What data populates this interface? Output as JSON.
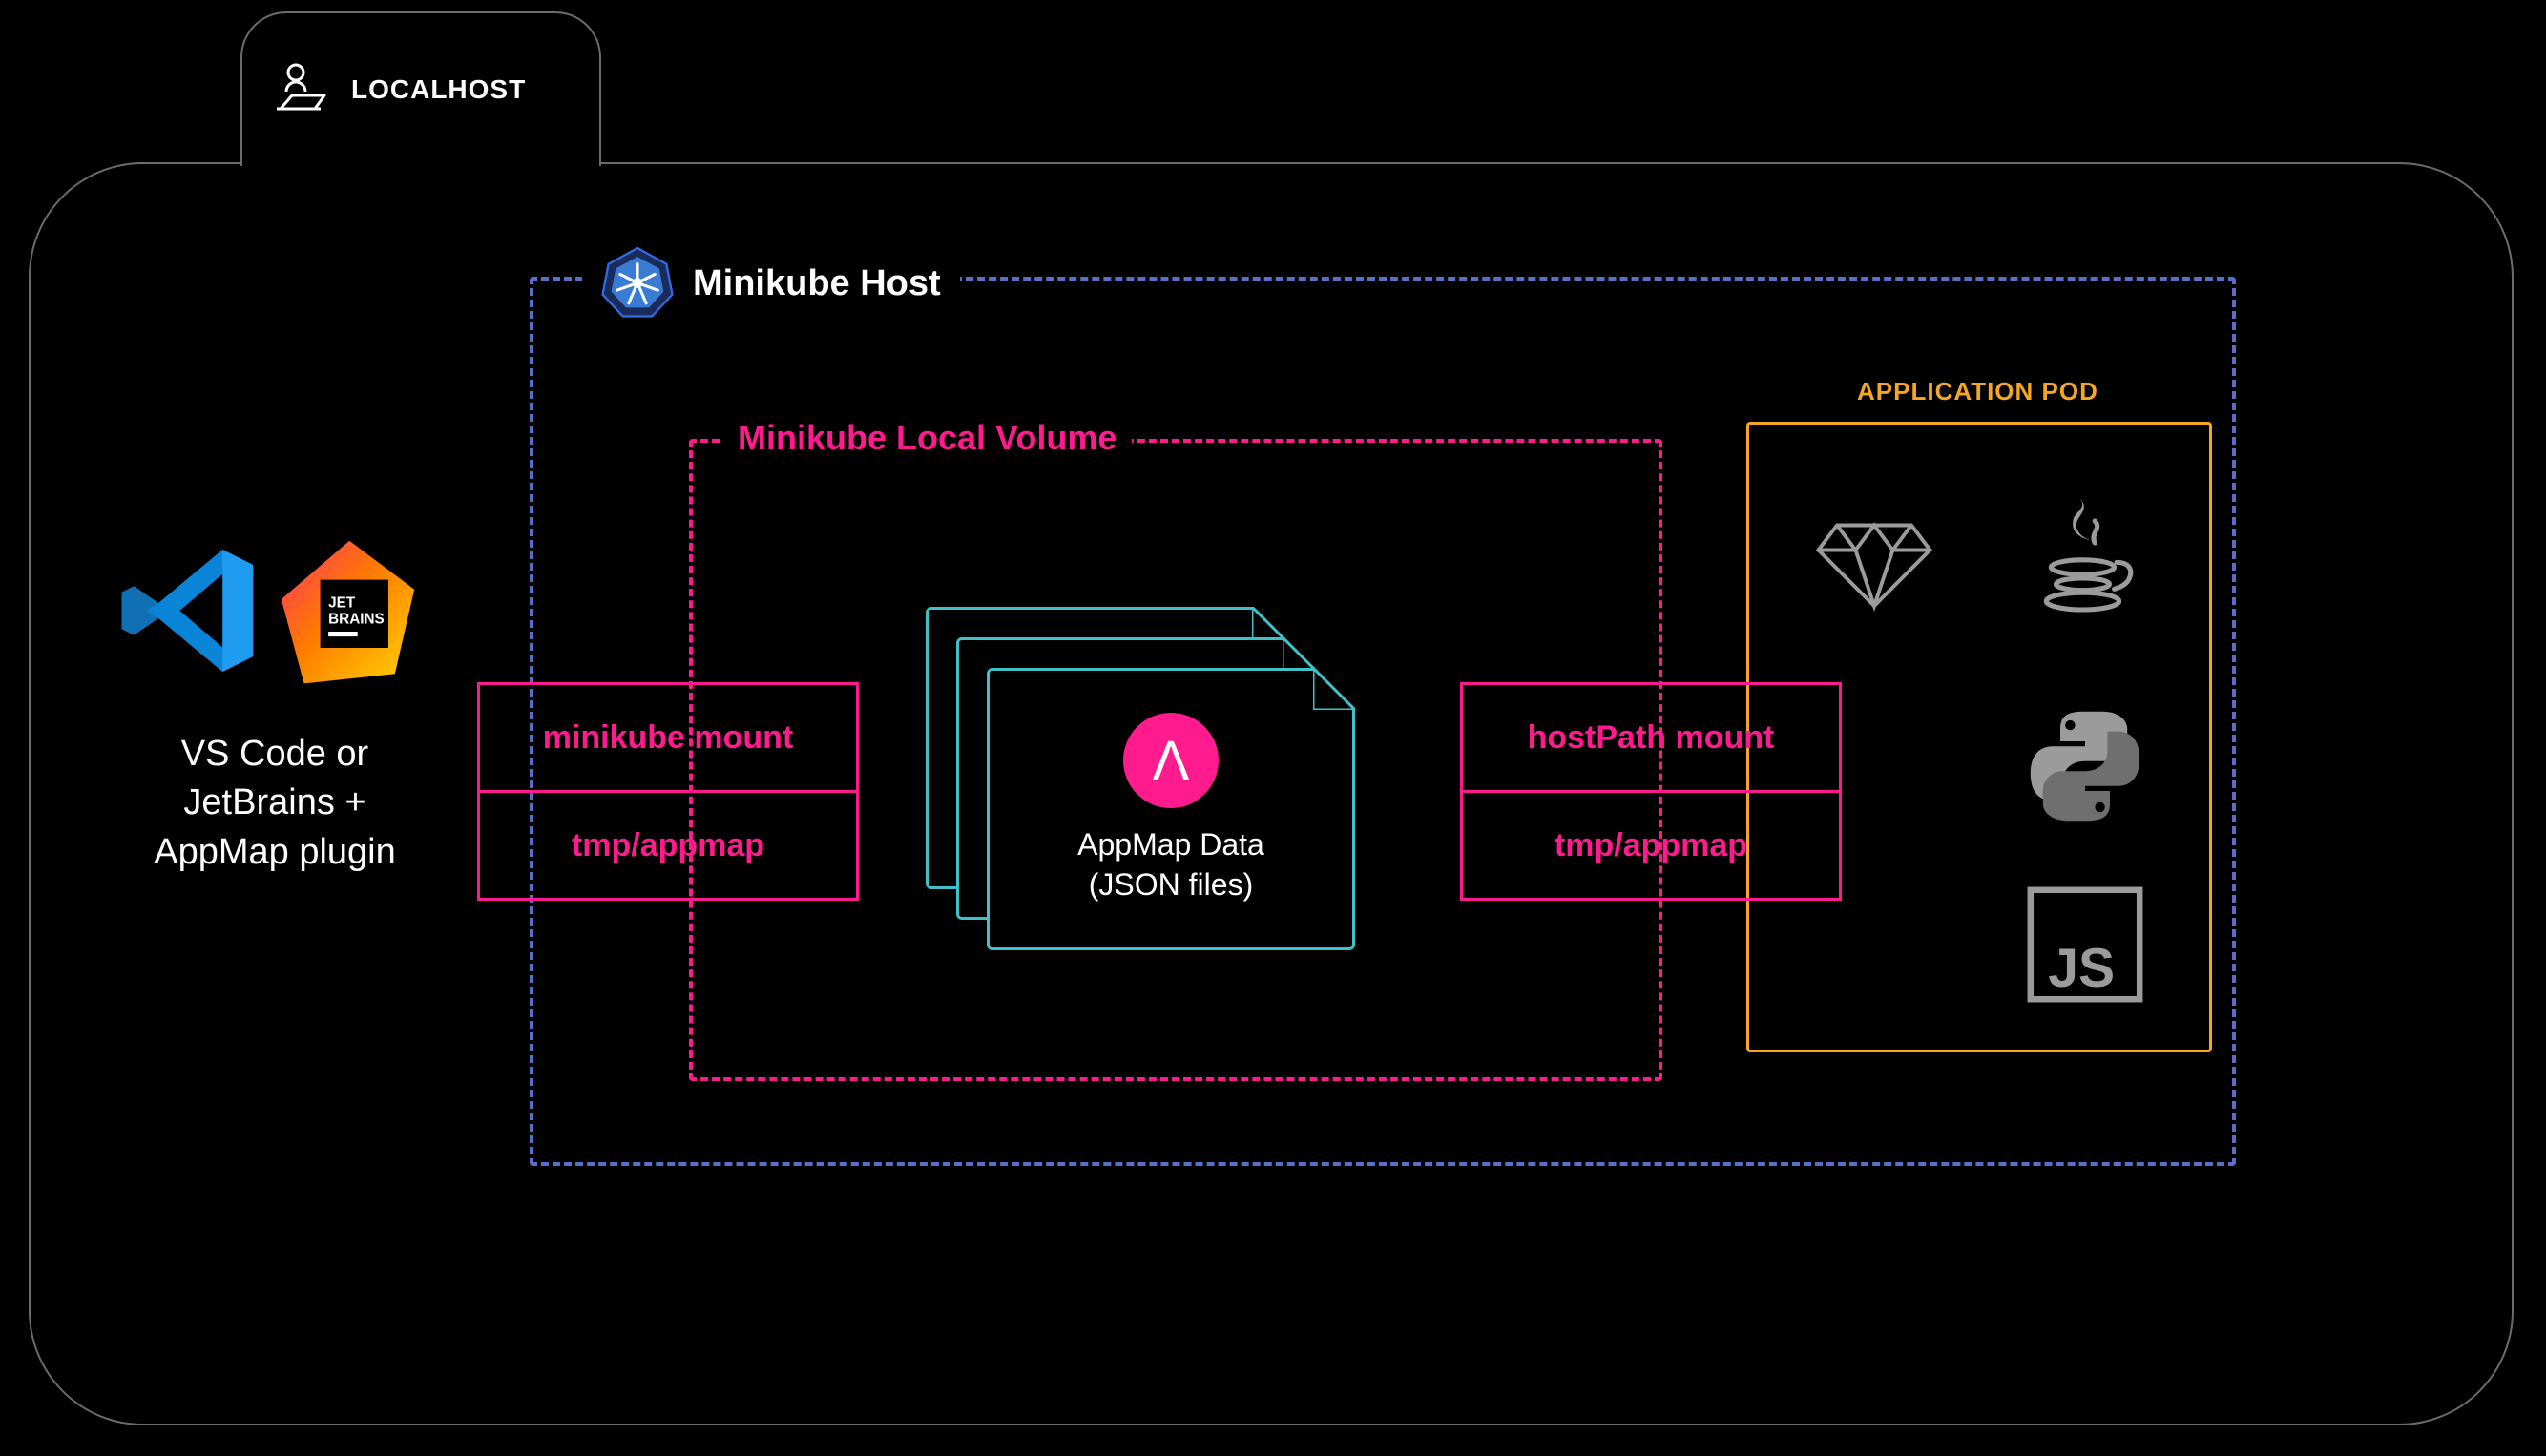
{
  "tab": {
    "label": "LOCALHOST"
  },
  "minikube_host": {
    "title": "Minikube Host"
  },
  "local_volume": {
    "title": "Minikube Local Volume"
  },
  "app_pod": {
    "label": "APPLICATION POD",
    "langs": [
      "ruby",
      "java",
      "python",
      "javascript"
    ]
  },
  "ide": {
    "caption_line1": "VS Code or",
    "caption_line2": "JetBrains +",
    "caption_line3": "AppMap plugin"
  },
  "mount_left": {
    "row1": "minikube mount",
    "row2": "tmp/appmap"
  },
  "mount_right": {
    "row1": "hostPath mount",
    "row2": "tmp/appmap"
  },
  "appmap_data": {
    "title": "AppMap Data",
    "subtitle": "(JSON files)"
  },
  "colors": {
    "pink": "#ff1b8d",
    "teal": "#3fc1c9",
    "orange": "#f5a623",
    "blue_dash": "#5a6fc9"
  }
}
